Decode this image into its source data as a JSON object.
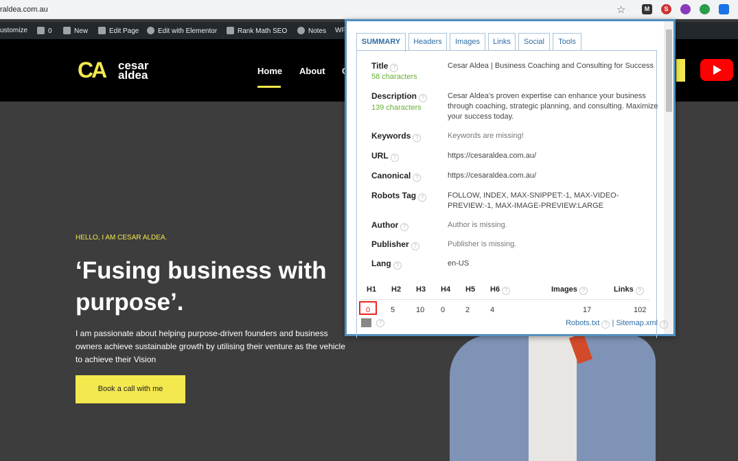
{
  "browser": {
    "url": "raldea.com.au"
  },
  "admin_bar": {
    "items": [
      "ustomize",
      "0",
      "New",
      "Edit Page",
      "Edit with Elementor",
      "Rank Math SEO",
      "Notes",
      "WP"
    ]
  },
  "site": {
    "logo_mark": "CA",
    "logo_line1": "cesar",
    "logo_line2": "aldea",
    "nav": [
      "Home",
      "About"
    ],
    "nav_cut": "C"
  },
  "hero": {
    "eyebrow": "HELLO, I AM CESAR ALDEA.",
    "headline": "‘Fusing business with purpose’.",
    "lead": "I am passionate about helping purpose-driven founders and business owners achieve sustainable growth by utilising their venture as the vehicle to achieve their Vision",
    "cta": "Book a call with me"
  },
  "popup": {
    "tabs": [
      "SUMMARY",
      "Headers",
      "Images",
      "Links",
      "Social",
      "Tools"
    ],
    "active_tab": "SUMMARY",
    "help_glyph": "?",
    "title": {
      "label": "Title",
      "sub": "58 characters",
      "value": "Cesar Aldea | Business Coaching and Consulting for Success"
    },
    "description": {
      "label": "Description",
      "sub": "139 characters",
      "value": "Cesar Aldea's proven expertise can enhance your business through coaching, strategic planning, and consulting. Maximize your success today."
    },
    "keywords": {
      "label": "Keywords",
      "value": "Keywords are missing!"
    },
    "url": {
      "label": "URL",
      "value": "https://cesaraldea.com.au/"
    },
    "canonical": {
      "label": "Canonical",
      "value": "https://cesaraldea.com.au/"
    },
    "robots": {
      "label": "Robots Tag",
      "value": "FOLLOW, INDEX, MAX-SNIPPET:-1, MAX-VIDEO-PREVIEW:-1, MAX-IMAGE-PREVIEW:LARGE"
    },
    "author": {
      "label": "Author",
      "value": "Author is missing."
    },
    "publisher": {
      "label": "Publisher",
      "value": "Publisher is missing."
    },
    "lang": {
      "label": "Lang",
      "value": "en-US"
    },
    "headings": {
      "labels": [
        "H1",
        "H2",
        "H3",
        "H4",
        "H5",
        "H6",
        "Images",
        "Links"
      ],
      "values": [
        "0",
        "5",
        "10",
        "0",
        "2",
        "4",
        "17",
        "102"
      ]
    },
    "footer_links": {
      "robots": "Robots.txt",
      "separator": "|",
      "sitemap": "Sitemap.xml"
    }
  },
  "colors": {
    "accent_yellow": "#f3e84e",
    "link_blue": "#2e6da4",
    "ok_green": "#66b032",
    "alert_red": "#ee2222"
  }
}
